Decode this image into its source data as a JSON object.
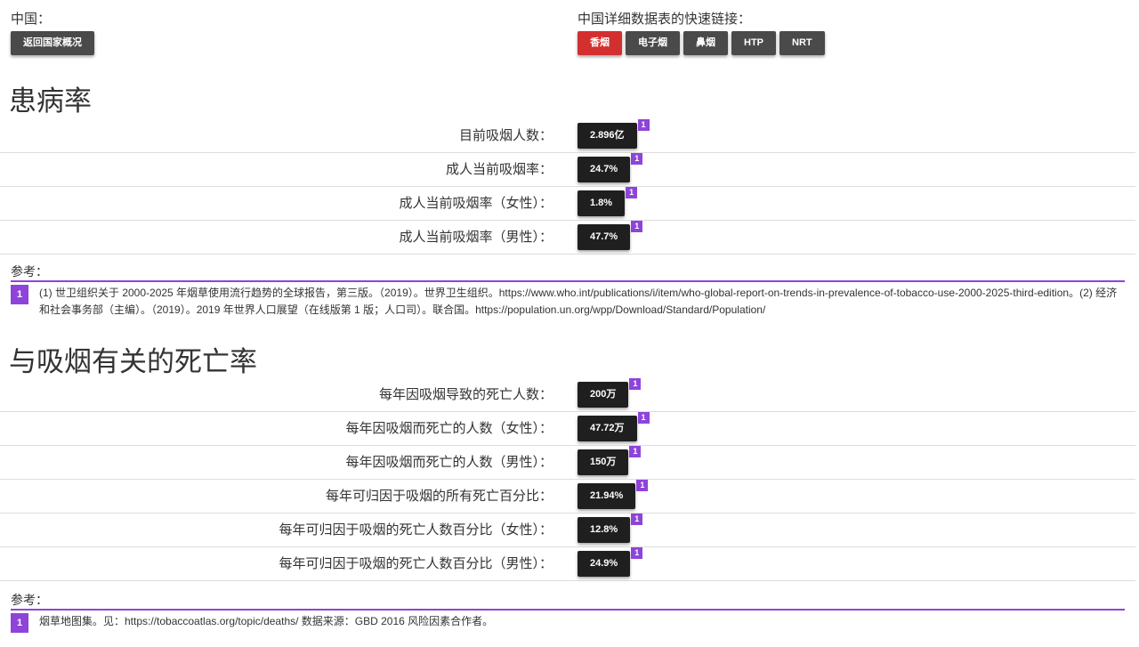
{
  "header": {
    "country_label": "中国：",
    "back_button": "返回国家概况",
    "quick_links_label": "中国详细数据表的快速链接：",
    "quick_links": [
      {
        "label": "香烟",
        "active": true
      },
      {
        "label": "电子烟",
        "active": false
      },
      {
        "label": "鼻烟",
        "active": false
      },
      {
        "label": "HTP",
        "active": false
      },
      {
        "label": "NRT",
        "active": false
      }
    ]
  },
  "prevalence": {
    "title": "患病率",
    "rows": [
      {
        "label": "目前吸烟人数：",
        "value": "2.896亿",
        "ref": "1"
      },
      {
        "label": "成人当前吸烟率：",
        "value": "24.7%",
        "ref": "1"
      },
      {
        "label": "成人当前吸烟率（女性）：",
        "value": "1.8%",
        "ref": "1"
      },
      {
        "label": "成人当前吸烟率（男性）：",
        "value": "47.7%",
        "ref": "1"
      }
    ],
    "refs_title": "参考：",
    "refs": [
      {
        "num": "1",
        "text": "(1) 世卫组织关于 2000-2025 年烟草使用流行趋势的全球报告，第三版。（2019）。世界卫生组织。https://www.who.int/publications/i/item/who-global-report-on-trends-in-prevalence-of-tobacco-use-2000-2025-third-edition。(2) 经济和社会事务部（主编）。（2019）。2019 年世界人口展望（在线版第 1 版；人口司）。联合国。https://population.un.org/wpp/Download/Standard/Population/"
      }
    ]
  },
  "mortality": {
    "title": "与吸烟有关的死亡率",
    "rows": [
      {
        "label": "每年因吸烟导致的死亡人数：",
        "value": "200万",
        "ref": "1"
      },
      {
        "label": "每年因吸烟而死亡的人数（女性）：",
        "value": "47.72万",
        "ref": "1"
      },
      {
        "label": "每年因吸烟而死亡的人数（男性）：",
        "value": "150万",
        "ref": "1"
      },
      {
        "label": "每年可归因于吸烟的所有死亡百分比：",
        "value": "21.94%",
        "ref": "1"
      },
      {
        "label": "每年可归因于吸烟的死亡人数百分比（女性）：",
        "value": "12.8%",
        "ref": "1"
      },
      {
        "label": "每年可归因于吸烟的死亡人数百分比（男性）：",
        "value": "24.9%",
        "ref": "1"
      }
    ],
    "refs_title": "参考：",
    "refs": [
      {
        "num": "1",
        "text": "烟草地图集。见：https://tobaccoatlas.org/topic/deaths/ 数据来源：GBD 2016 风险因素合作者。"
      }
    ]
  },
  "colors": {
    "accent_purple": "#8e44d9",
    "active_red": "#d32f2f",
    "button_dark": "#4a4a4a",
    "value_dark": "#1f1f1f"
  }
}
